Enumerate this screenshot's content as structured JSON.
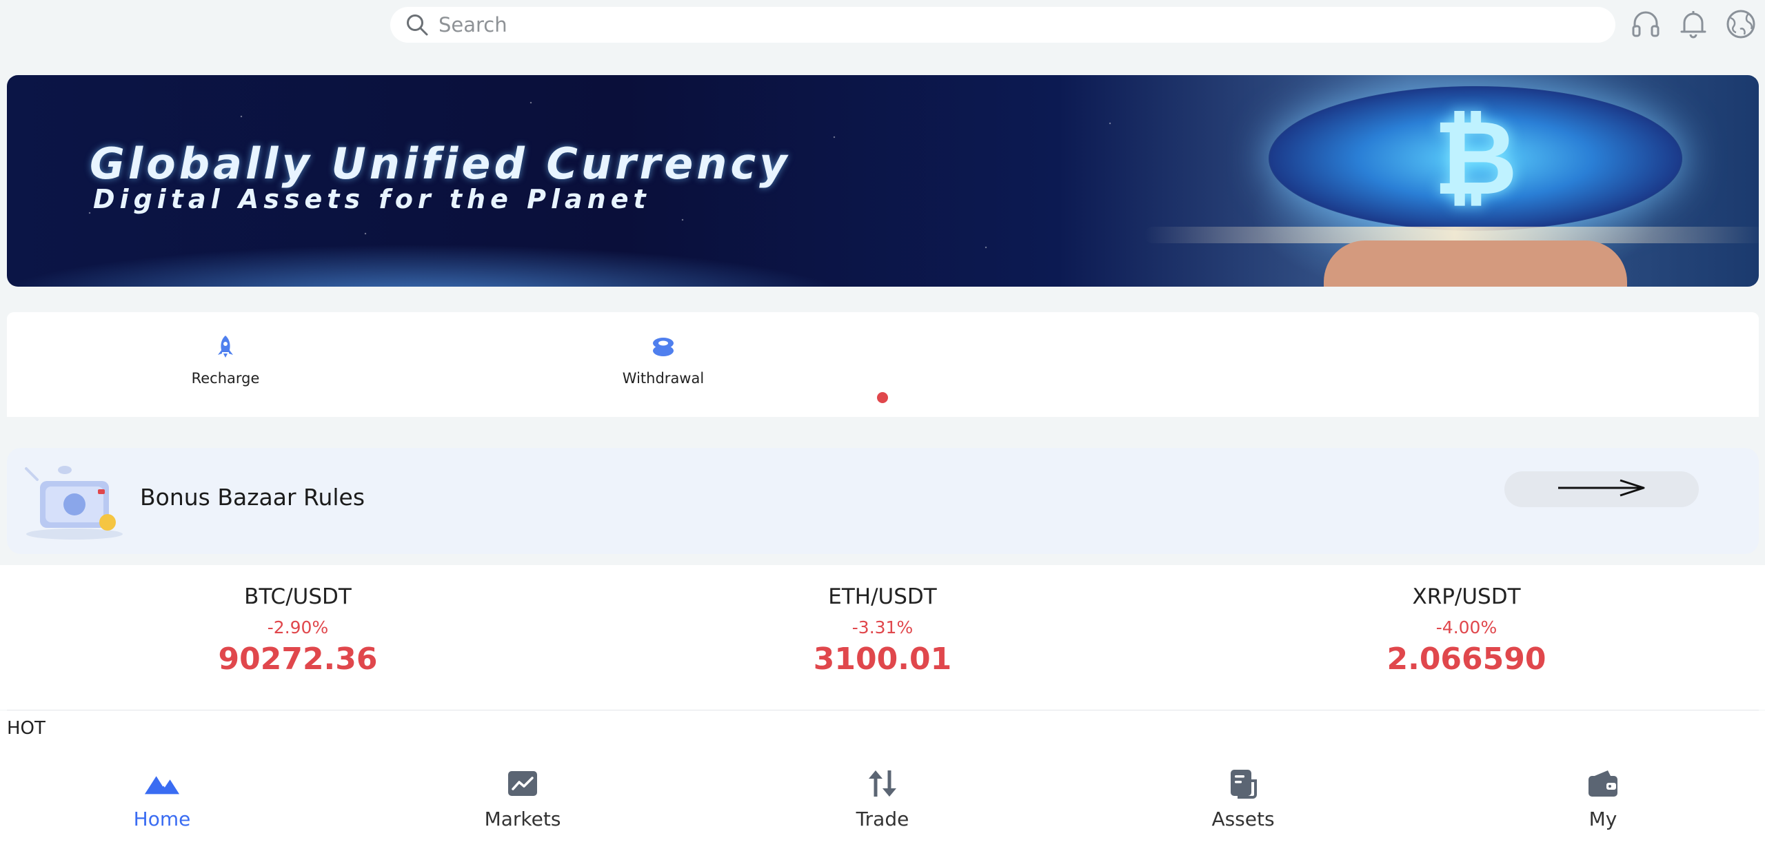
{
  "search": {
    "placeholder": "Search"
  },
  "top_icons": [
    "headset-icon",
    "bell-icon",
    "globe-icon"
  ],
  "banner": {
    "headline": "Globally Unified Currency",
    "subline": "Digital Assets for the Planet",
    "coin_symbol": "₿"
  },
  "quick_actions": [
    {
      "label": "Recharge",
      "icon": "rocket-icon"
    },
    {
      "label": "Withdrawal",
      "icon": "coin-stack-icon"
    }
  ],
  "bonus": {
    "title": "Bonus Bazaar Rules"
  },
  "tickers": [
    {
      "pair": "BTC/USDT",
      "change": "-2.90%",
      "price": "90272.36"
    },
    {
      "pair": "ETH/USDT",
      "change": "-3.31%",
      "price": "3100.01"
    },
    {
      "pair": "XRP/USDT",
      "change": "-4.00%",
      "price": "2.066590"
    }
  ],
  "section": {
    "hot_label": "HOT"
  },
  "nav": [
    {
      "label": "Home",
      "icon": "home-icon",
      "active": true
    },
    {
      "label": "Markets",
      "icon": "chart-icon",
      "active": false
    },
    {
      "label": "Trade",
      "icon": "trade-arrows-icon",
      "active": false
    },
    {
      "label": "Assets",
      "icon": "document-icon",
      "active": false
    },
    {
      "label": "My",
      "icon": "wallet-icon",
      "active": false
    }
  ],
  "colors": {
    "accent": "#3a6cf2",
    "negative": "#e0474c",
    "icon_gray": "#5b6573",
    "background": "#f2f5f6"
  }
}
